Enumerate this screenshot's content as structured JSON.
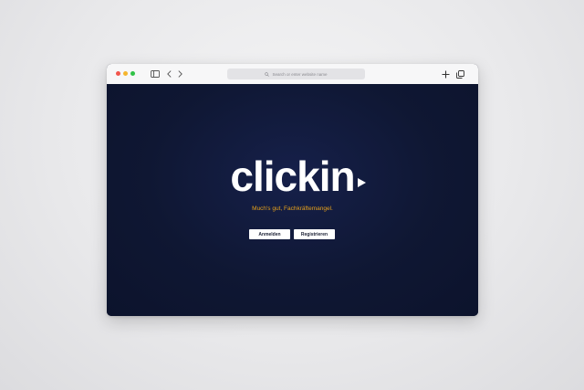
{
  "browser": {
    "address_placeholder": "Search or enter website name"
  },
  "page": {
    "logo_text": "clickin",
    "tagline": "Much's gut, Fachkräftemangel.",
    "login_label": "Anmelden",
    "register_label": "Registrieren"
  },
  "icons": {
    "toolbar": [
      "close-dot",
      "minimize-dot",
      "maximize-dot",
      "sidebar-icon",
      "back-icon",
      "forward-icon",
      "search-icon",
      "new-tab-icon",
      "tabs-overview-icon"
    ],
    "logo": "play-arrow-icon"
  },
  "colors": {
    "page_background": "#0f1733",
    "tagline": "#e8a21a",
    "button_background": "#ffffff",
    "window_close": "#f2564d",
    "window_minimize": "#f5b52e",
    "window_maximize": "#30c247"
  }
}
